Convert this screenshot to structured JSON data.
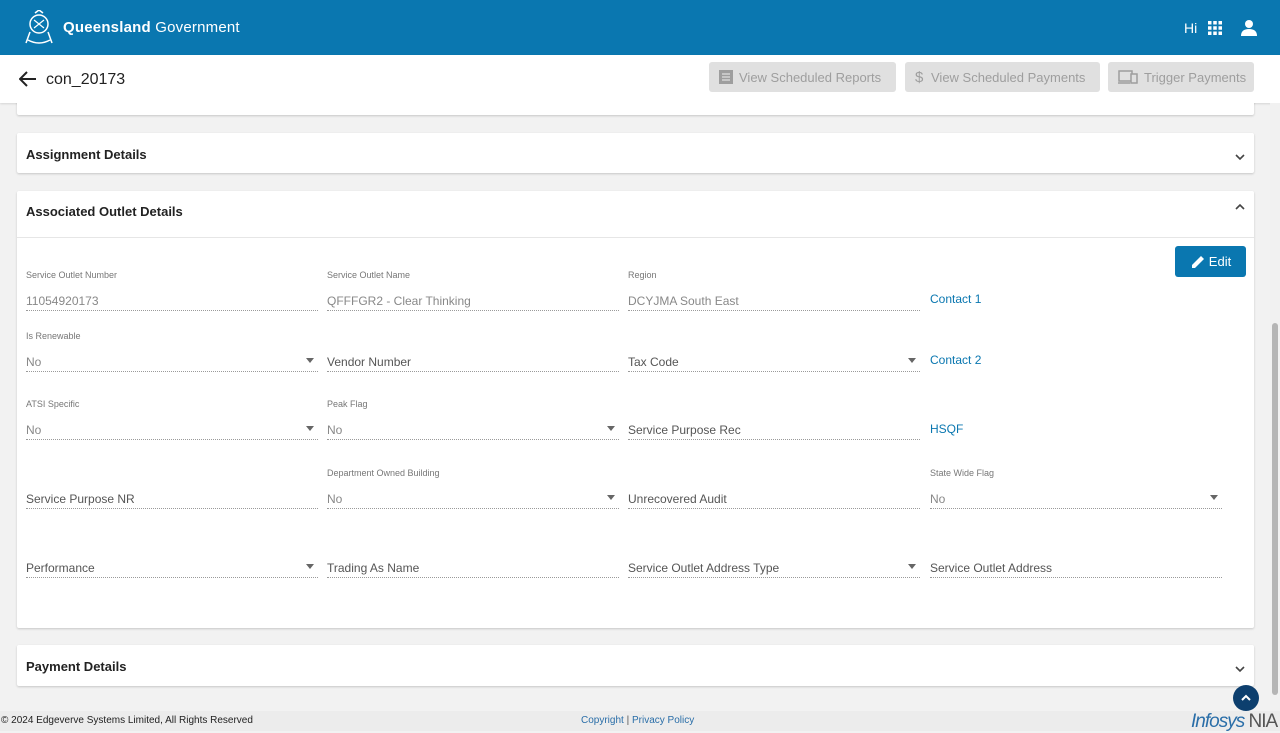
{
  "topbar": {
    "brand_bold": "Queensland",
    "brand_rest": "Government",
    "greeting": "Hi",
    "icons": [
      "qld-crest-icon",
      "apps-grid-icon",
      "user-icon"
    ]
  },
  "subheader": {
    "title": "con_20173",
    "buttons": {
      "view_reports": "View Scheduled Reports",
      "view_payments": "View Scheduled Payments",
      "trigger_payments": "Trigger Payments"
    }
  },
  "panels": {
    "assignment": "Assignment Details",
    "associated_outlet": "Associated Outlet Details",
    "payment": "Payment Details"
  },
  "outlet": {
    "edit_label": "Edit",
    "service_outlet_number": {
      "label": "Service Outlet Number",
      "value": "11054920173"
    },
    "service_outlet_name": {
      "label": "Service Outlet Name",
      "value": "QFFFGR2 - Clear Thinking"
    },
    "region": {
      "label": "Region",
      "value": "DCYJMA South East"
    },
    "contact1": "Contact 1",
    "is_renewable": {
      "label": "Is Renewable",
      "value": "No"
    },
    "vendor_number": "Vendor Number",
    "tax_code": "Tax Code",
    "contact2": "Contact 2",
    "atsi_specific": {
      "label": "ATSI Specific",
      "value": "No"
    },
    "peak_flag": {
      "label": "Peak Flag",
      "value": "No"
    },
    "service_purpose_rec": "Service Purpose Rec",
    "hsqf": "HSQF",
    "service_purpose_nr": "Service Purpose NR",
    "department_owned_building": {
      "label": "Department Owned Building",
      "value": "No"
    },
    "unrecovered_audit": "Unrecovered Audit",
    "state_wide_flag": {
      "label": "State Wide Flag",
      "value": "No"
    },
    "performance": "Performance",
    "trading_as_name": "Trading As Name",
    "service_outlet_address_type": "Service Outlet Address Type",
    "service_outlet_address": "Service Outlet Address"
  },
  "footer": {
    "copyright": "© 2024 Edgeverve Systems Limited, All Rights Reserved",
    "copyright_link": "Copyright",
    "separator": "|",
    "privacy_link": "Privacy Policy",
    "logo_infosys": "Infosys",
    "logo_nia": "NIA"
  },
  "colors": {
    "primary": "#0a77b0",
    "disabled_button": "#e0e0e0",
    "scroll_top": "#0d3f6e"
  }
}
